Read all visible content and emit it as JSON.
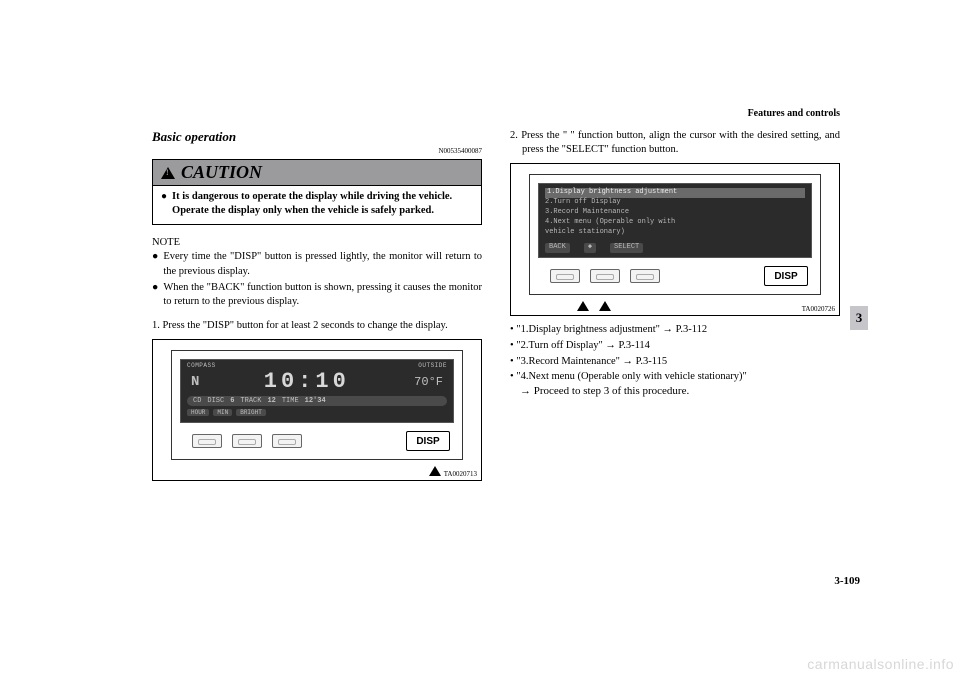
{
  "header": {
    "category": "Features and controls"
  },
  "left": {
    "section_title": "Basic operation",
    "code_id": "N00535400087",
    "caution": {
      "label": "CAUTION",
      "text": "It is dangerous to operate the display while driving the vehicle. Operate the display only when the vehicle is safely parked."
    },
    "note_label": "NOTE",
    "notes": [
      "Every time the \"DISP\" button is pressed lightly, the monitor will return to the previous display.",
      "When the \"BACK\" function button is shown, pressing it causes the monitor to return to the previous display."
    ],
    "step1": "1. Press the \"DISP\" button for at least 2 seconds to change the display.",
    "fig1": {
      "id": "TA0020713",
      "labels": {
        "compass": "COMPASS",
        "outside": "OUTSIDE",
        "n": "N",
        "time": "10:10",
        "temp": "70°F",
        "cd": "CD",
        "disc_lbl": "DISC",
        "disc": "6",
        "track_lbl": "TRACK",
        "track": "12",
        "time_lbl": "TIME",
        "ttime": "12'34",
        "hour": "HOUR",
        "min": "MIN",
        "bright": "BRIGHT",
        "disp_btn": "DISP"
      }
    }
  },
  "right": {
    "step2": "2. Press the \"   \" function button, align the cursor with the desired setting, and press the \"SELECT\" function button.",
    "fig2": {
      "id": "TA0020726",
      "menu": {
        "l1": "1.Display brightness adjustment",
        "l2": "2.Turn off Display",
        "l3": "3.Record Maintenance",
        "l4a": "4.Next menu (Operable only with",
        "l4b": "  vehicle stationary)",
        "back": "BACK",
        "select": "SELECT"
      },
      "disp_btn": "DISP"
    },
    "refs": {
      "r1": "\"1.Display brightness adjustment\" → P.3-112",
      "r2": "\"2.Turn off Display\" → P.3-114",
      "r3": "\"3.Record Maintenance\" → P.3-115",
      "r4": "\"4.Next menu (Operable only with vehicle stationary)\"",
      "r4sub": "→ Proceed to step 3 of this procedure."
    }
  },
  "side_tab": "3",
  "page_num": "3-109",
  "watermark": "carmanualsonline.info"
}
